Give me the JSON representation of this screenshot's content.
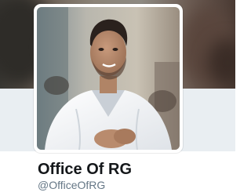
{
  "profile": {
    "display_name": "Office Of RG",
    "screen_name": "@OfficeOfRG"
  },
  "colors": {
    "name_text": "#14171a",
    "handle_text": "#657786",
    "lower_band": "#e9eef2"
  }
}
